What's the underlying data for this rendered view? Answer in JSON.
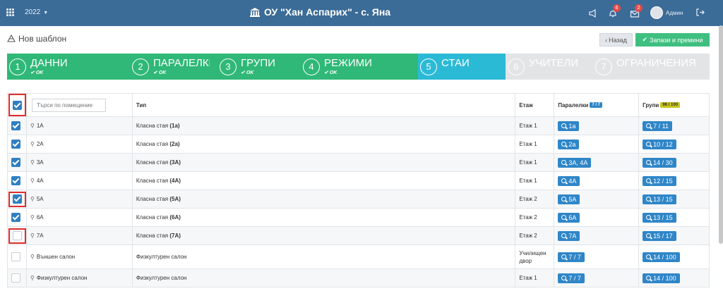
{
  "topbar": {
    "year": "2022",
    "title": "ОУ \"Хан Аспарих\" - с. Яна",
    "badge_notifications": "6",
    "badge_messages": "2",
    "user": "Админ"
  },
  "header": {
    "page_title": "Нов шаблон",
    "back_label": "Назад",
    "save_label": "Запази и премини"
  },
  "steps": [
    {
      "num": "1",
      "label": "ДАННИ",
      "status": "OK",
      "color": "#2fb877"
    },
    {
      "num": "2",
      "label": "ПАРАЛЕЛКИ",
      "status": "OK",
      "color": "#2fb877"
    },
    {
      "num": "3",
      "label": "ГРУПИ",
      "status": "OK",
      "color": "#2fb877"
    },
    {
      "num": "4",
      "label": "РЕЖИМИ",
      "status": "OK",
      "color": "#2fb877"
    },
    {
      "num": "5",
      "label": "СТАИ",
      "status": "",
      "color": "#2bbad6"
    },
    {
      "num": "6",
      "label": "УЧИТЕЛИ",
      "status": "",
      "color": "#e2e4e6"
    },
    {
      "num": "7",
      "label": "ОГРАНИЧЕНИЯ",
      "status": "",
      "color": "#e2e4e6"
    }
  ],
  "table": {
    "search_placeholder": "Търси по помещение",
    "col_type": "Тип",
    "col_floor": "Етаж",
    "col_classes": "Паралелки",
    "classes_badge": "7 / 7",
    "col_groups": "Групи",
    "groups_badge": "98 / 100",
    "rows": [
      {
        "checked": true,
        "room": "1А",
        "type_prefix": "Класна стая",
        "type_bold": "(1а)",
        "floor": "Етаж 1",
        "classes": "1а",
        "groups": "7 / 11"
      },
      {
        "checked": true,
        "room": "2А",
        "type_prefix": "Класна стая",
        "type_bold": "(2а)",
        "floor": "Етаж 1",
        "classes": "2а",
        "groups": "10 / 12"
      },
      {
        "checked": true,
        "room": "3А",
        "type_prefix": "Класна стая",
        "type_bold": "(3А)",
        "floor": "Етаж 1",
        "classes": "3А, 4А",
        "groups": "14 / 30"
      },
      {
        "checked": true,
        "room": "4А",
        "type_prefix": "Класна стая",
        "type_bold": "(4А)",
        "floor": "Етаж 1",
        "classes": "4А",
        "groups": "12 / 15"
      },
      {
        "checked": true,
        "room": "5А",
        "type_prefix": "Класна стая",
        "type_bold": "(5А)",
        "floor": "Етаж 2",
        "classes": "5А",
        "groups": "13 / 15"
      },
      {
        "checked": true,
        "room": "6А",
        "type_prefix": "Класна стая",
        "type_bold": "(6А)",
        "floor": "Етаж 2",
        "classes": "6А",
        "groups": "13 / 15"
      },
      {
        "checked": false,
        "room": "7А",
        "type_prefix": "Класна стая",
        "type_bold": "(7А)",
        "floor": "Етаж 2",
        "classes": "7А",
        "groups": "15 / 17"
      },
      {
        "checked": false,
        "room": "Външен салон",
        "type_prefix": "Физкултурен салон",
        "type_bold": "",
        "floor": "Училищен двор",
        "classes": "7 / 7",
        "groups": "14 / 100"
      },
      {
        "checked": false,
        "room": "Физкултурен салон",
        "type_prefix": "Физкултурен салон",
        "type_bold": "",
        "floor": "Етаж 1",
        "classes": "7 / 7",
        "groups": "14 / 100"
      }
    ]
  }
}
